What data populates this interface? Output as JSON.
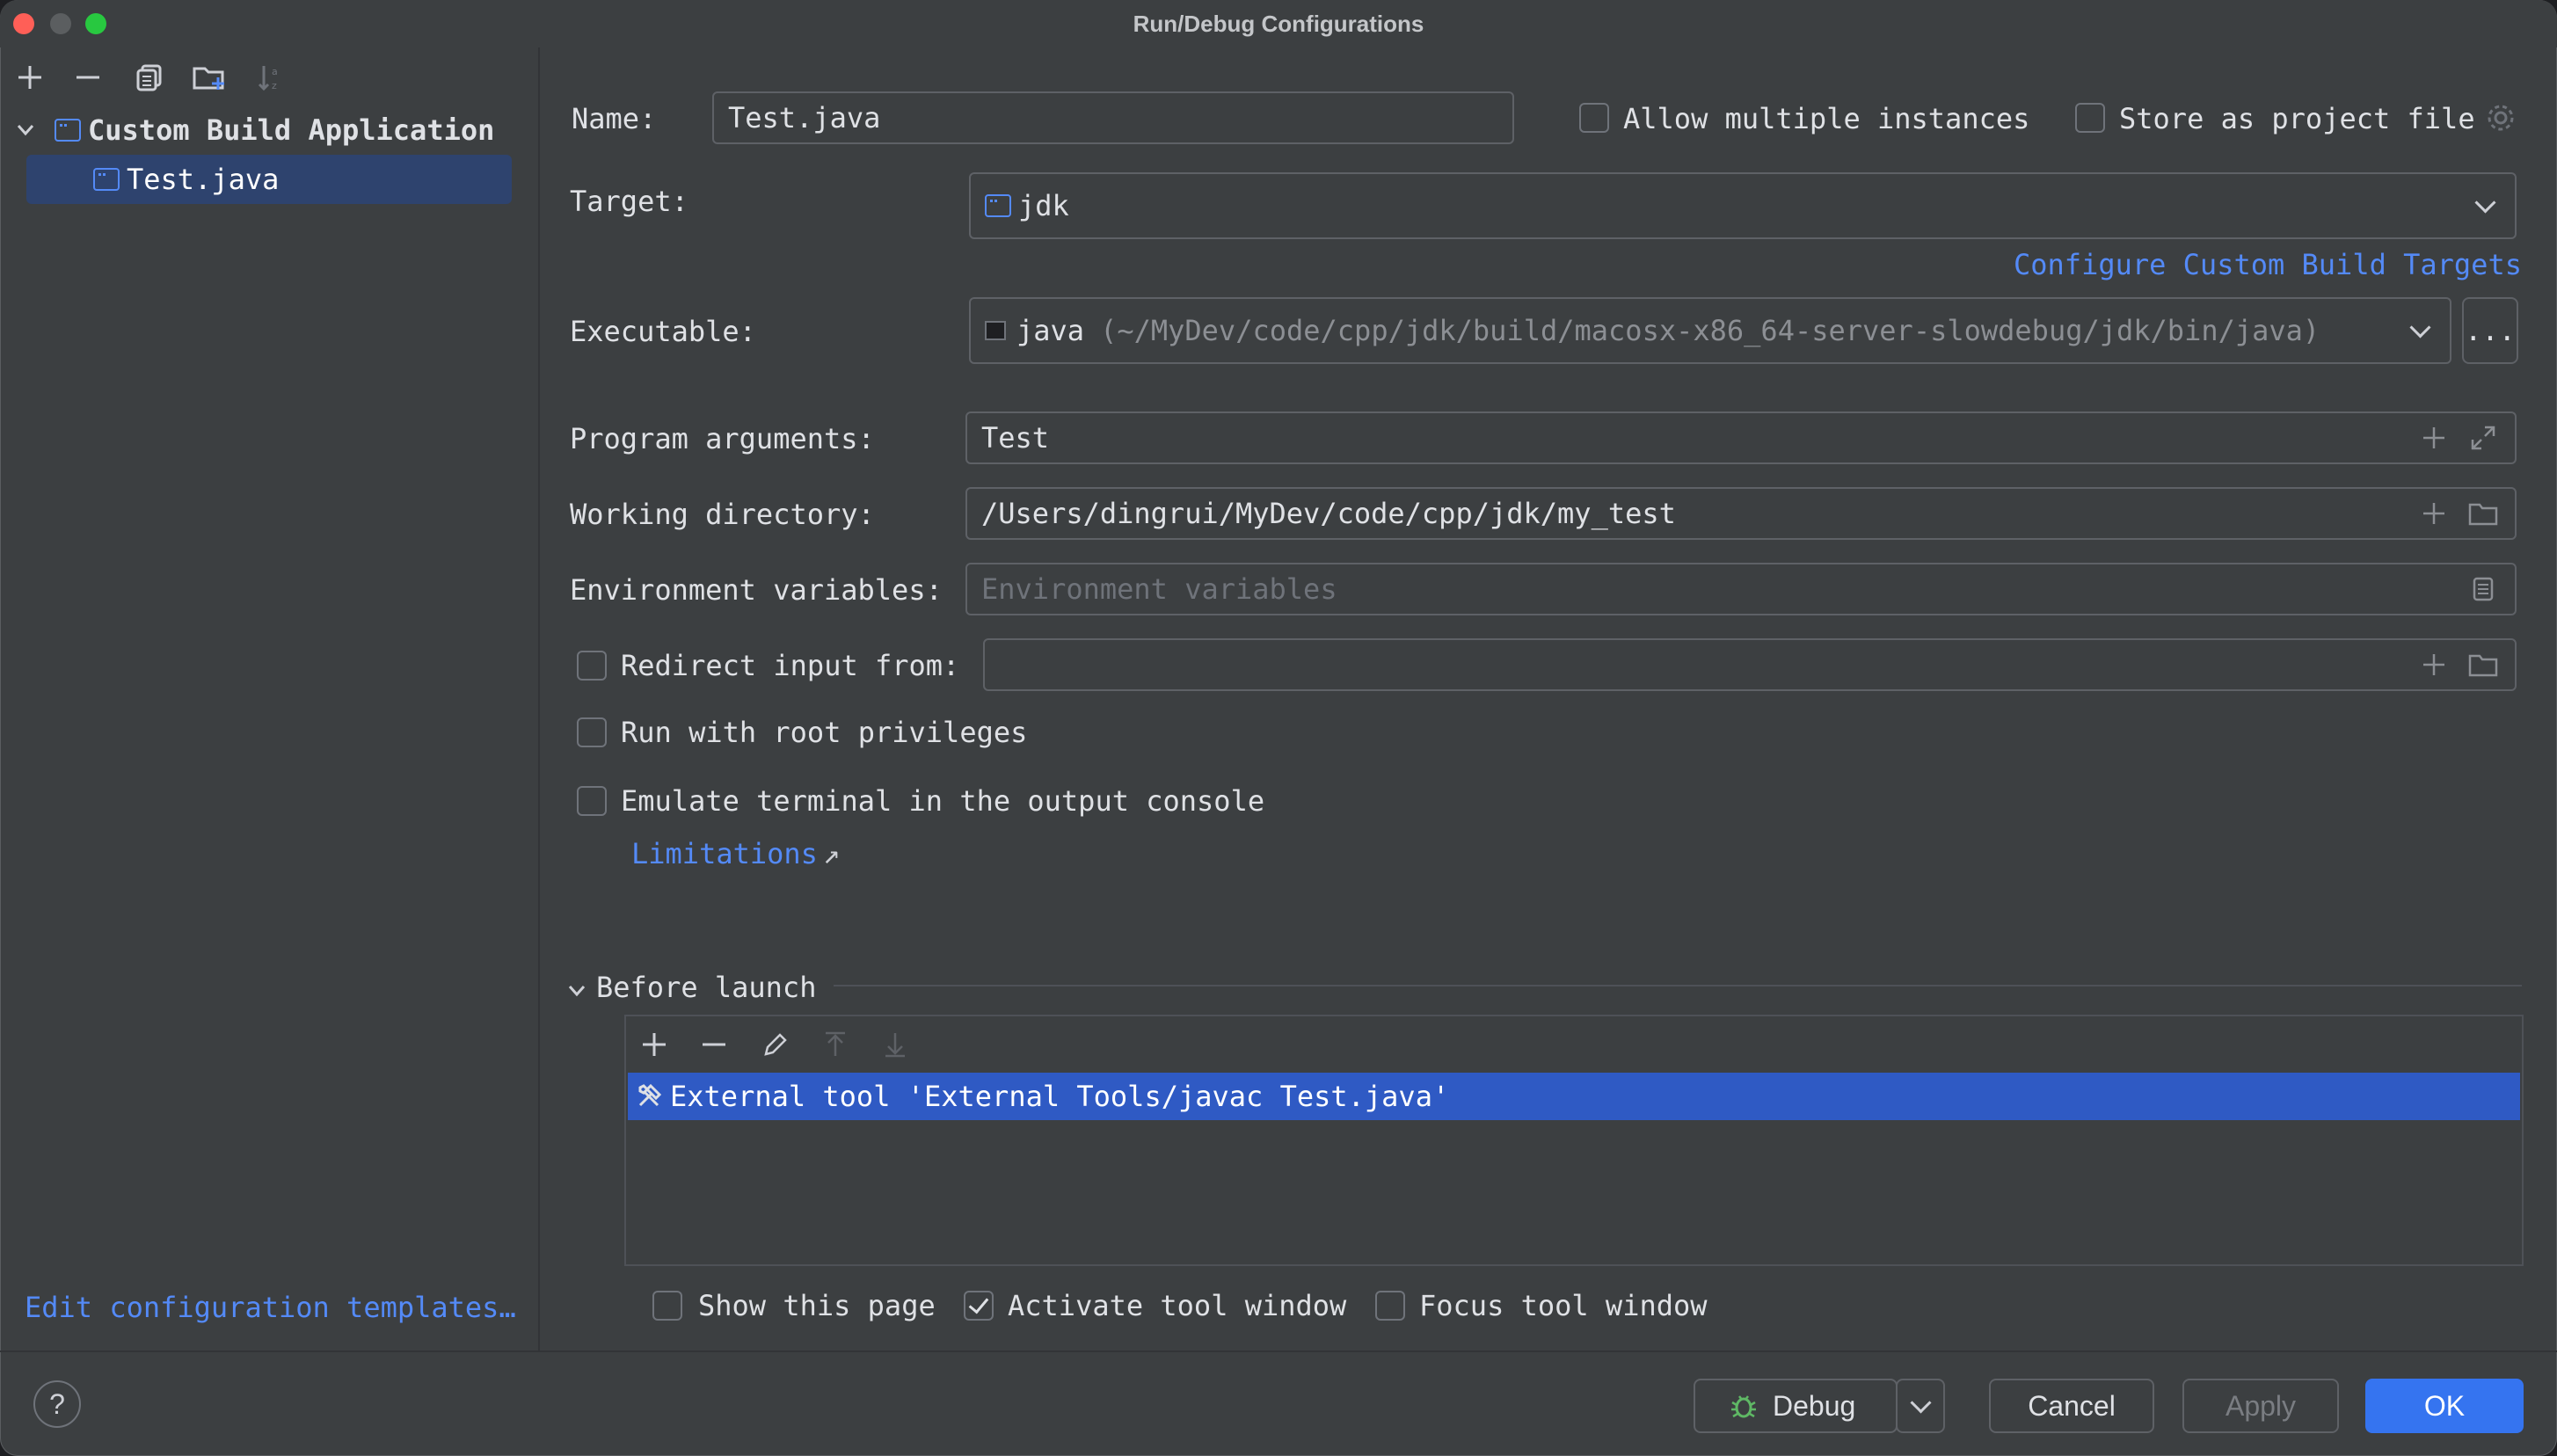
{
  "window": {
    "title": "Run/Debug Configurations"
  },
  "sidebar": {
    "tree": {
      "group_label": "Custom Build Application",
      "items": [
        {
          "label": "Test.java",
          "selected": true
        }
      ]
    },
    "edit_templates_link": "Edit configuration templates…"
  },
  "form": {
    "name": {
      "label": "Name:",
      "value": "Test.java"
    },
    "allow_multiple": {
      "label": "Allow multiple instances",
      "checked": false
    },
    "store_as_project": {
      "label": "Store as project file",
      "checked": false
    },
    "target": {
      "label": "Target:",
      "value": "jdk"
    },
    "configure_targets_link": "Configure Custom Build Targets",
    "executable": {
      "label": "Executable:",
      "name": "java",
      "path": "(~/MyDev/code/cpp/jdk/build/macosx-x86_64-server-slowdebug/jdk/bin/java)",
      "browse_label": "..."
    },
    "program_arguments": {
      "label": "Program arguments:",
      "value": "Test"
    },
    "working_directory": {
      "label": "Working directory:",
      "value": "/Users/dingrui/MyDev/code/cpp/jdk/my_test"
    },
    "environment_variables": {
      "label": "Environment variables:",
      "placeholder": "Environment variables"
    },
    "redirect_input": {
      "label": "Redirect input from:",
      "checked": false,
      "value": ""
    },
    "run_root": {
      "label": "Run with root privileges",
      "checked": false
    },
    "emulate_terminal": {
      "label": "Emulate terminal in the output console",
      "checked": false
    },
    "limitations_link": "Limitations",
    "limitations_arrow": "↗"
  },
  "before_launch": {
    "title": "Before launch",
    "tasks": [
      {
        "label": "External tool 'External Tools/javac Test.java'",
        "selected": true
      }
    ],
    "show_this_page": {
      "label": "Show this page",
      "checked": false
    },
    "activate_tool_window": {
      "label": "Activate tool window",
      "checked": true
    },
    "focus_tool_window": {
      "label": "Focus tool window",
      "checked": false
    }
  },
  "footer": {
    "help_label": "?",
    "debug_label": "Debug",
    "cancel_label": "Cancel",
    "apply_label": "Apply",
    "ok_label": "OK"
  },
  "colors": {
    "accent": "#3574f0",
    "link": "#548af7",
    "selection": "#2f5ac4",
    "tree_selection": "#2e436e"
  },
  "icons": {
    "toolbar": [
      "plus-icon",
      "minus-icon",
      "copy-icon",
      "new-folder-icon",
      "sort-icon"
    ],
    "before_launch_toolbar": [
      "plus-icon",
      "minus-icon",
      "edit-icon",
      "move-up-icon",
      "move-down-icon"
    ]
  }
}
